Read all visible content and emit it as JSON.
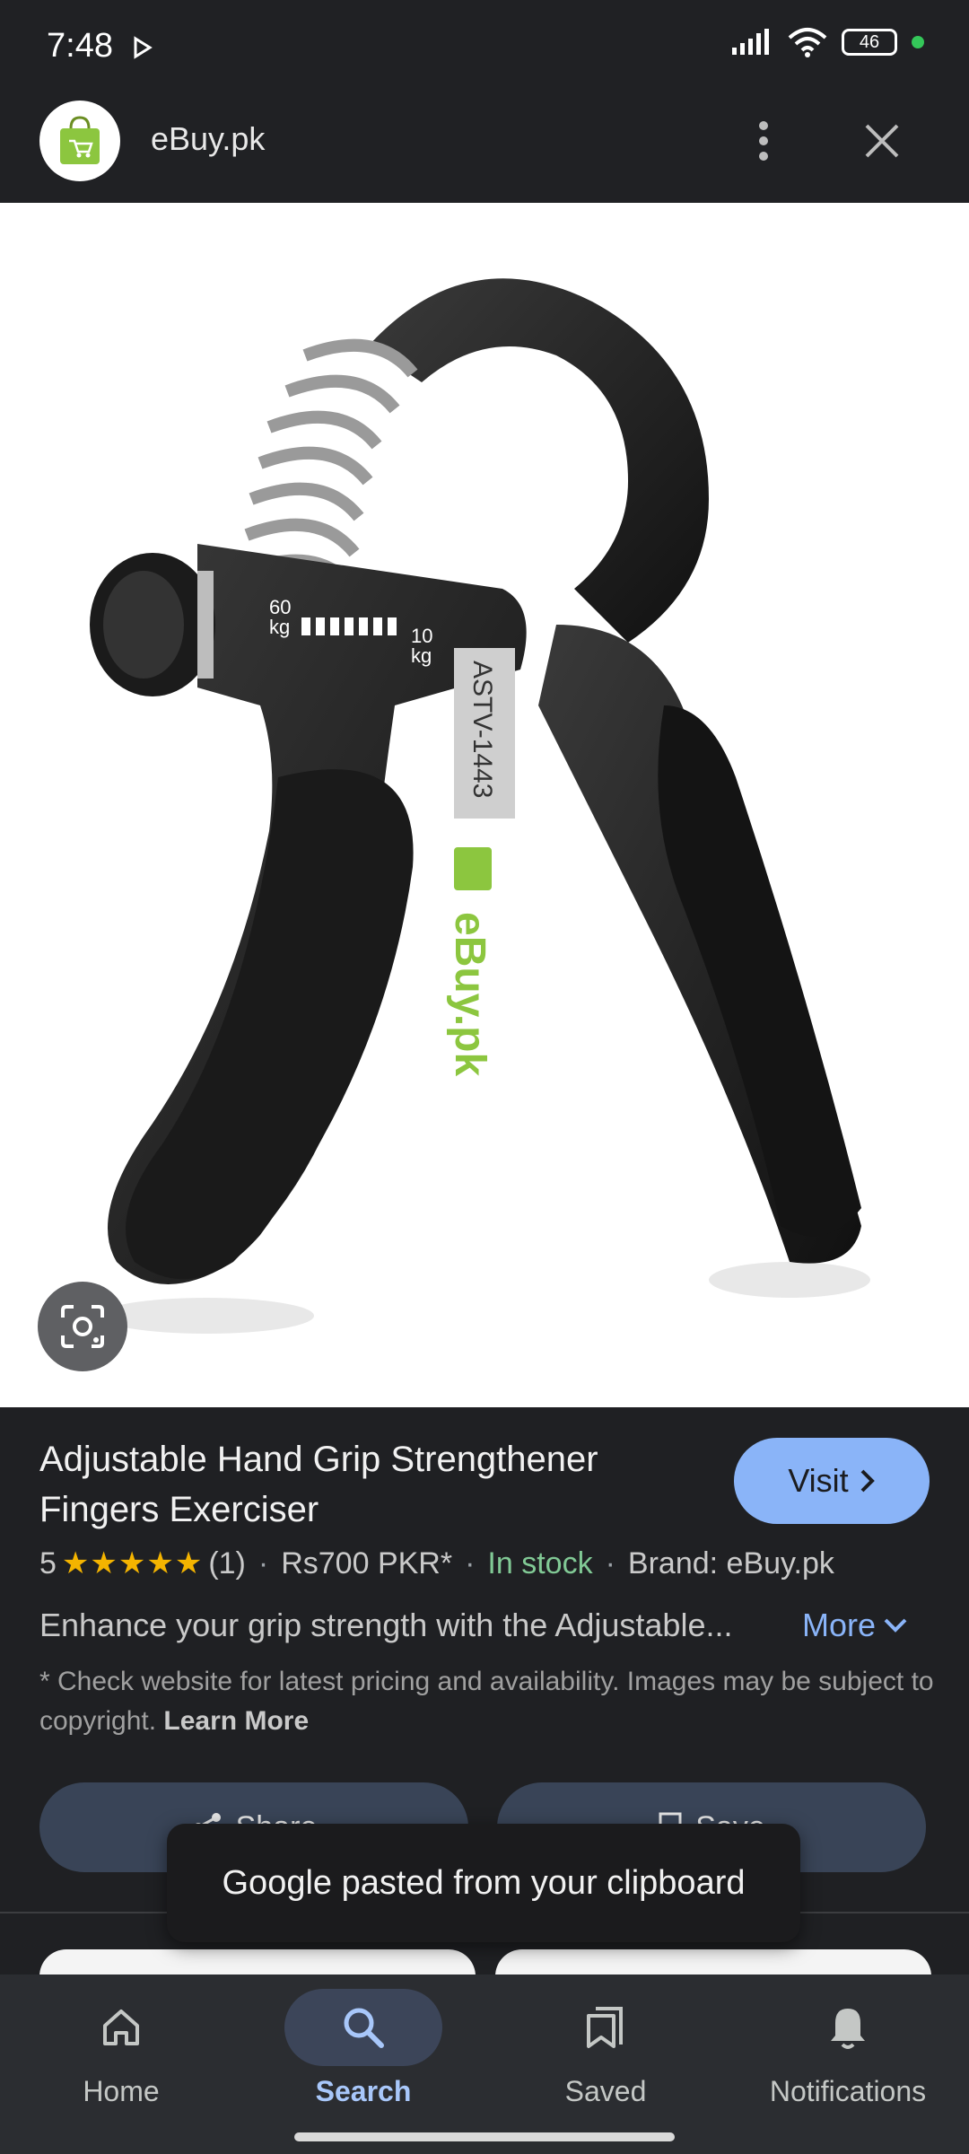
{
  "status_bar": {
    "time": "7:48",
    "battery": "46"
  },
  "header": {
    "site_name": "eBuy.pk"
  },
  "product": {
    "hero_tag": "ASTV-1443",
    "scale_high": "60",
    "scale_low": "10",
    "scale_unit": "kg",
    "watermark": "eBuy.pk",
    "title": "Adjustable Hand Grip Strengthener Fingers Exerciser",
    "visit_label": "Visit",
    "rating_value": "5",
    "rating_stars": 5,
    "review_count": "(1)",
    "price": "Rs700 PKR*",
    "availability": "In stock",
    "brand": "Brand: eBuy.pk",
    "description": "Enhance your grip strength with the Adjustable...",
    "more_label": "More",
    "disclaimer": "* Check website for latest pricing and availability. Images may be subject to copyright.",
    "learn_more": "Learn More"
  },
  "actions": {
    "share_label": "Share",
    "save_label": "Save"
  },
  "toast": {
    "message": "Google pasted from your clipboard"
  },
  "bottom_nav": {
    "items": [
      {
        "label": "Home",
        "icon": "home-icon",
        "active": false
      },
      {
        "label": "Search",
        "icon": "search-icon",
        "active": true
      },
      {
        "label": "Saved",
        "icon": "saved-icon",
        "active": false
      },
      {
        "label": "Notifications",
        "icon": "bell-icon",
        "active": false
      }
    ]
  },
  "colors": {
    "background": "#1f2023",
    "accent": "#8ab4f8",
    "in_stock": "#81c995",
    "star": "#f4b400",
    "nav_active": "#a8c7fa"
  }
}
